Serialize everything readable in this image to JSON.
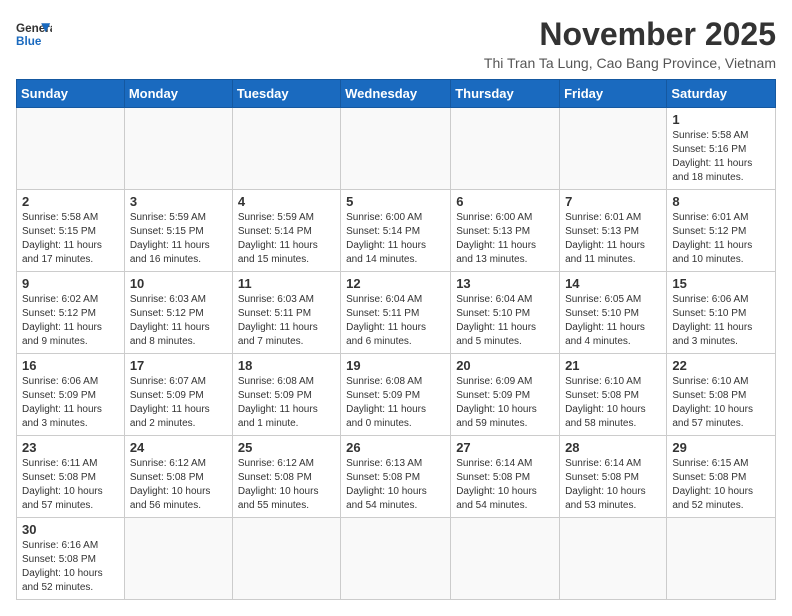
{
  "logo": {
    "text_general": "General",
    "text_blue": "Blue"
  },
  "title": "November 2025",
  "subtitle": "Thi Tran Ta Lung, Cao Bang Province, Vietnam",
  "days_of_week": [
    "Sunday",
    "Monday",
    "Tuesday",
    "Wednesday",
    "Thursday",
    "Friday",
    "Saturday"
  ],
  "weeks": [
    [
      {
        "day": "",
        "info": ""
      },
      {
        "day": "",
        "info": ""
      },
      {
        "day": "",
        "info": ""
      },
      {
        "day": "",
        "info": ""
      },
      {
        "day": "",
        "info": ""
      },
      {
        "day": "",
        "info": ""
      },
      {
        "day": "1",
        "info": "Sunrise: 5:58 AM\nSunset: 5:16 PM\nDaylight: 11 hours and 18 minutes."
      }
    ],
    [
      {
        "day": "2",
        "info": "Sunrise: 5:58 AM\nSunset: 5:15 PM\nDaylight: 11 hours and 17 minutes."
      },
      {
        "day": "3",
        "info": "Sunrise: 5:59 AM\nSunset: 5:15 PM\nDaylight: 11 hours and 16 minutes."
      },
      {
        "day": "4",
        "info": "Sunrise: 5:59 AM\nSunset: 5:14 PM\nDaylight: 11 hours and 15 minutes."
      },
      {
        "day": "5",
        "info": "Sunrise: 6:00 AM\nSunset: 5:14 PM\nDaylight: 11 hours and 14 minutes."
      },
      {
        "day": "6",
        "info": "Sunrise: 6:00 AM\nSunset: 5:13 PM\nDaylight: 11 hours and 13 minutes."
      },
      {
        "day": "7",
        "info": "Sunrise: 6:01 AM\nSunset: 5:13 PM\nDaylight: 11 hours and 11 minutes."
      },
      {
        "day": "8",
        "info": "Sunrise: 6:01 AM\nSunset: 5:12 PM\nDaylight: 11 hours and 10 minutes."
      }
    ],
    [
      {
        "day": "9",
        "info": "Sunrise: 6:02 AM\nSunset: 5:12 PM\nDaylight: 11 hours and 9 minutes."
      },
      {
        "day": "10",
        "info": "Sunrise: 6:03 AM\nSunset: 5:12 PM\nDaylight: 11 hours and 8 minutes."
      },
      {
        "day": "11",
        "info": "Sunrise: 6:03 AM\nSunset: 5:11 PM\nDaylight: 11 hours and 7 minutes."
      },
      {
        "day": "12",
        "info": "Sunrise: 6:04 AM\nSunset: 5:11 PM\nDaylight: 11 hours and 6 minutes."
      },
      {
        "day": "13",
        "info": "Sunrise: 6:04 AM\nSunset: 5:10 PM\nDaylight: 11 hours and 5 minutes."
      },
      {
        "day": "14",
        "info": "Sunrise: 6:05 AM\nSunset: 5:10 PM\nDaylight: 11 hours and 4 minutes."
      },
      {
        "day": "15",
        "info": "Sunrise: 6:06 AM\nSunset: 5:10 PM\nDaylight: 11 hours and 3 minutes."
      }
    ],
    [
      {
        "day": "16",
        "info": "Sunrise: 6:06 AM\nSunset: 5:09 PM\nDaylight: 11 hours and 3 minutes."
      },
      {
        "day": "17",
        "info": "Sunrise: 6:07 AM\nSunset: 5:09 PM\nDaylight: 11 hours and 2 minutes."
      },
      {
        "day": "18",
        "info": "Sunrise: 6:08 AM\nSunset: 5:09 PM\nDaylight: 11 hours and 1 minute."
      },
      {
        "day": "19",
        "info": "Sunrise: 6:08 AM\nSunset: 5:09 PM\nDaylight: 11 hours and 0 minutes."
      },
      {
        "day": "20",
        "info": "Sunrise: 6:09 AM\nSunset: 5:09 PM\nDaylight: 10 hours and 59 minutes."
      },
      {
        "day": "21",
        "info": "Sunrise: 6:10 AM\nSunset: 5:08 PM\nDaylight: 10 hours and 58 minutes."
      },
      {
        "day": "22",
        "info": "Sunrise: 6:10 AM\nSunset: 5:08 PM\nDaylight: 10 hours and 57 minutes."
      }
    ],
    [
      {
        "day": "23",
        "info": "Sunrise: 6:11 AM\nSunset: 5:08 PM\nDaylight: 10 hours and 57 minutes."
      },
      {
        "day": "24",
        "info": "Sunrise: 6:12 AM\nSunset: 5:08 PM\nDaylight: 10 hours and 56 minutes."
      },
      {
        "day": "25",
        "info": "Sunrise: 6:12 AM\nSunset: 5:08 PM\nDaylight: 10 hours and 55 minutes."
      },
      {
        "day": "26",
        "info": "Sunrise: 6:13 AM\nSunset: 5:08 PM\nDaylight: 10 hours and 54 minutes."
      },
      {
        "day": "27",
        "info": "Sunrise: 6:14 AM\nSunset: 5:08 PM\nDaylight: 10 hours and 54 minutes."
      },
      {
        "day": "28",
        "info": "Sunrise: 6:14 AM\nSunset: 5:08 PM\nDaylight: 10 hours and 53 minutes."
      },
      {
        "day": "29",
        "info": "Sunrise: 6:15 AM\nSunset: 5:08 PM\nDaylight: 10 hours and 52 minutes."
      }
    ],
    [
      {
        "day": "30",
        "info": "Sunrise: 6:16 AM\nSunset: 5:08 PM\nDaylight: 10 hours and 52 minutes."
      },
      {
        "day": "",
        "info": ""
      },
      {
        "day": "",
        "info": ""
      },
      {
        "day": "",
        "info": ""
      },
      {
        "day": "",
        "info": ""
      },
      {
        "day": "",
        "info": ""
      },
      {
        "day": "",
        "info": ""
      }
    ]
  ]
}
